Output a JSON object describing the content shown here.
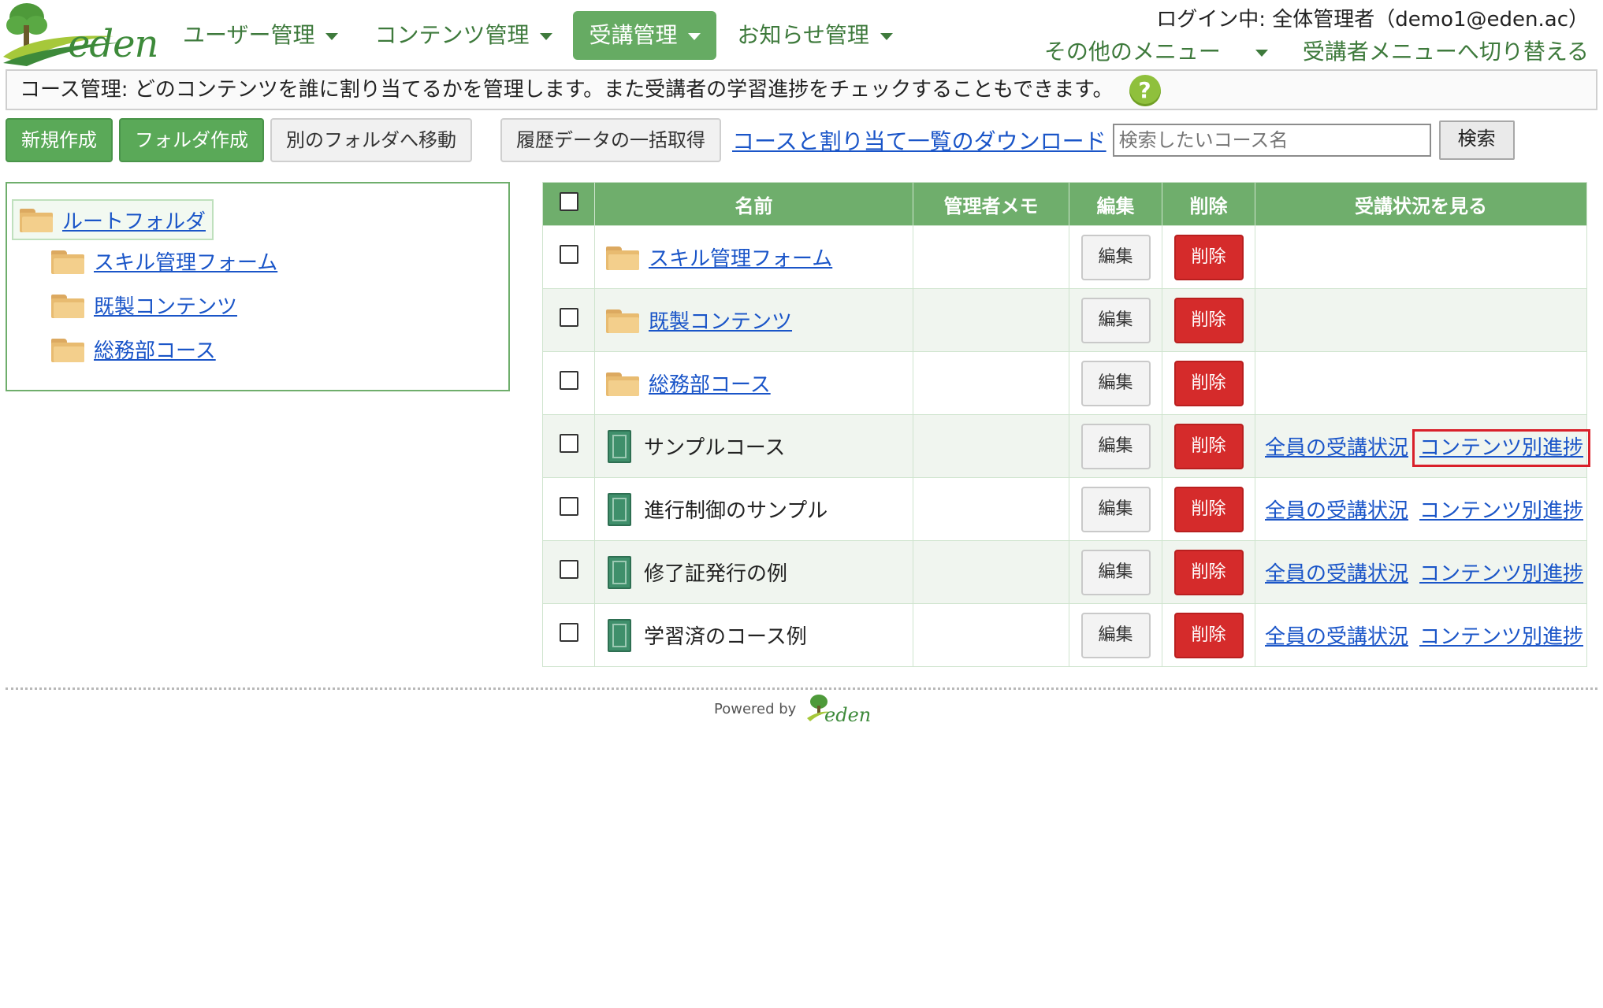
{
  "app": {
    "logo_text": "eden"
  },
  "nav": {
    "items": [
      {
        "label": "ユーザー管理"
      },
      {
        "label": "コンテンツ管理"
      },
      {
        "label": "受講管理"
      },
      {
        "label": "お知らせ管理"
      }
    ],
    "active_index": 2
  },
  "user": {
    "login_text": "ログイン中: 全体管理者（demo1@eden.ac）"
  },
  "sub_nav": {
    "other_menu": "その他のメニュー",
    "switch_learner": "受講者メニューへ切り替える"
  },
  "info": {
    "text": "コース管理: どのコンテンツを誰に割り当てるかを管理します。また受講者の学習進捗をチェックすることもできます。",
    "help": "?"
  },
  "toolbar": {
    "new_label": "新規作成",
    "folder_label": "フォルダ作成",
    "move_label": "別のフォルダへ移動",
    "history_label": "履歴データの一括取得",
    "download_link": "コースと割り当て一覧のダウンロード",
    "search_placeholder": "検索したいコース名",
    "search_label": "検索"
  },
  "tree": {
    "root": "ルートフォルダ",
    "children": [
      "スキル管理フォーム",
      "既製コンテンツ",
      "総務部コース"
    ]
  },
  "table": {
    "headers": {
      "name": "名前",
      "memo": "管理者メモ",
      "edit": "編集",
      "delete": "削除",
      "status": "受講状況を見る"
    },
    "edit_label": "編集",
    "delete_label": "削除",
    "all_status_label": "全員の受講状況",
    "content_progress_label": "コンテンツ別進捗",
    "rows": [
      {
        "type": "folder",
        "name": "スキル管理フォーム",
        "memo": ""
      },
      {
        "type": "folder",
        "name": "既製コンテンツ",
        "memo": ""
      },
      {
        "type": "folder",
        "name": "総務部コース",
        "memo": ""
      },
      {
        "type": "course",
        "name": "サンプルコース",
        "memo": ""
      },
      {
        "type": "course",
        "name": "進行制御のサンプル",
        "memo": ""
      },
      {
        "type": "course",
        "name": "修了証発行の例",
        "memo": ""
      },
      {
        "type": "course",
        "name": "学習済のコース例",
        "memo": ""
      }
    ]
  },
  "footer": {
    "powered_by": "Powered by",
    "logo_text": "eden"
  },
  "colors": {
    "brand_green": "#6fae6c",
    "danger_red": "#d52b2b",
    "link_blue": "#1a55c8"
  }
}
